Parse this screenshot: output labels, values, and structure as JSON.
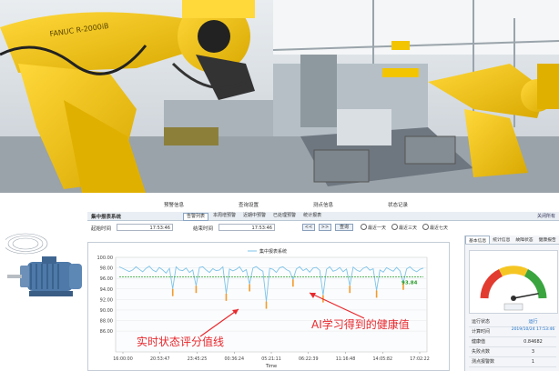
{
  "menu": [
    "预警信息",
    "查询设置",
    "测点信息",
    "状态记录"
  ],
  "tab_bar": {
    "title": "集中报表系统",
    "subtabs": [
      "告警列表",
      "本周增预警",
      "近期中预警",
      "已处理预警",
      "统计报表"
    ],
    "active_subtab": 0,
    "right_link": "关闭所有"
  },
  "filter": {
    "start_label": "起始时间",
    "start_value": "17:53:46",
    "end_label": "结束时间",
    "end_value": "17:53:46",
    "prev_button": "<<",
    "next_button": ">>",
    "query_button": "查询",
    "radios": [
      "最近一天",
      "最近三天",
      "最近七天"
    ]
  },
  "chart_data": {
    "type": "line",
    "title": "",
    "legend": [
      "集中报表系统"
    ],
    "ylim": [
      70,
      100
    ],
    "yticks": [
      100.0,
      98.0,
      96.0,
      94.0,
      92.0,
      90.0,
      88.0,
      86.0
    ],
    "xticks": [
      "16:00:00",
      "20:53:47",
      "23:45:25",
      "00:36:24",
      "05:21:11",
      "06:22:39",
      "11:16:48",
      "14:05:82",
      "17:02:22"
    ],
    "xlabel": "Time",
    "health_value_label": "93.84",
    "series": [
      {
        "name": "实时状态评分值线",
        "values": [
          97,
          96.5,
          96,
          95.5,
          96,
          97,
          96.2,
          95.4,
          96.5,
          97.2,
          96,
          95.4,
          96.8,
          96,
          95,
          96.5,
          90,
          97,
          96,
          95.8,
          96.6,
          95.2,
          96,
          91,
          96.8,
          97,
          96,
          95.2,
          96.4,
          95.8,
          96,
          97,
          88.5,
          96.3,
          95.7,
          96.2,
          97,
          95.4,
          96.1,
          91.5,
          96.6,
          97.1,
          96.2,
          95.6,
          86,
          96.5,
          96.2,
          95.2,
          96.7,
          97,
          96.1,
          95.6,
          93,
          96.3,
          97,
          95.8,
          96.4,
          95.3,
          96.6,
          96.8,
          95.9,
          88,
          96.2,
          97,
          95.6,
          96,
          96.8,
          95.4,
          96.3,
          91,
          96.9,
          96,
          95.5,
          96.5,
          97,
          95.9,
          96.4,
          89.5,
          96,
          95.3,
          96.7,
          96.1,
          95.6,
          96.8,
          95.7,
          92,
          96.3,
          97,
          96,
          95.4,
          96.2,
          96.6
        ]
      },
      {
        "name": "AI学习得到的健康值",
        "values": [
          93.8,
          93.8,
          93.8,
          93.8,
          93.8,
          93.8,
          93.8,
          93.8,
          93.8,
          93.8,
          93.8,
          93.8,
          93.8,
          93.8,
          93.8,
          93.8,
          93.8,
          93.8,
          93.8,
          93.8,
          93.8,
          93.8,
          93.8,
          93.8,
          93.8,
          93.8,
          93.8,
          93.8,
          93.8,
          93.8,
          93.8,
          93.8,
          93.8,
          93.8,
          93.8,
          93.8,
          93.8,
          93.8,
          93.8,
          93.8,
          93.8,
          93.8,
          93.8,
          93.8,
          93.8,
          93.8,
          93.8,
          93.8,
          93.8,
          93.8,
          93.8,
          93.8,
          93.8,
          93.8,
          93.8,
          93.8,
          93.8,
          93.8,
          93.8,
          93.8,
          93.8,
          93.8,
          93.8,
          93.8,
          93.8,
          93.8,
          93.8,
          93.8,
          93.8,
          93.8,
          93.8,
          93.8,
          93.8,
          93.8,
          93.8,
          93.8,
          93.8,
          93.8,
          93.8,
          93.8,
          93.8,
          93.8,
          93.8,
          93.8,
          93.8,
          93.8,
          93.8,
          93.8,
          93.8,
          93.8,
          93.8,
          93.8
        ]
      }
    ]
  },
  "annotations": {
    "realtime": "实时状态评分值线",
    "ai": "AI学习得到的健康值"
  },
  "right_panel": {
    "tabs": [
      "基本信息",
      "统计信息",
      "故障状态",
      "健康报告"
    ],
    "gauge_value": 94,
    "gauge_range": [
      0,
      100
    ],
    "info_rows": [
      {
        "k": "运行状态",
        "v": "运行"
      },
      {
        "k": "计算时间",
        "v": "2019/10/24 17:53:46"
      },
      {
        "k": "健康值",
        "v": "0.84682"
      },
      {
        "k": "失败点数",
        "v": "3"
      },
      {
        "k": "测点报警数",
        "v": "1"
      }
    ]
  },
  "colors": {
    "robot": "#f2c500",
    "line": "#7ec3e8",
    "spike": "#f39a2b",
    "health": "#2a9d2a",
    "annotation": "#e8282d"
  }
}
